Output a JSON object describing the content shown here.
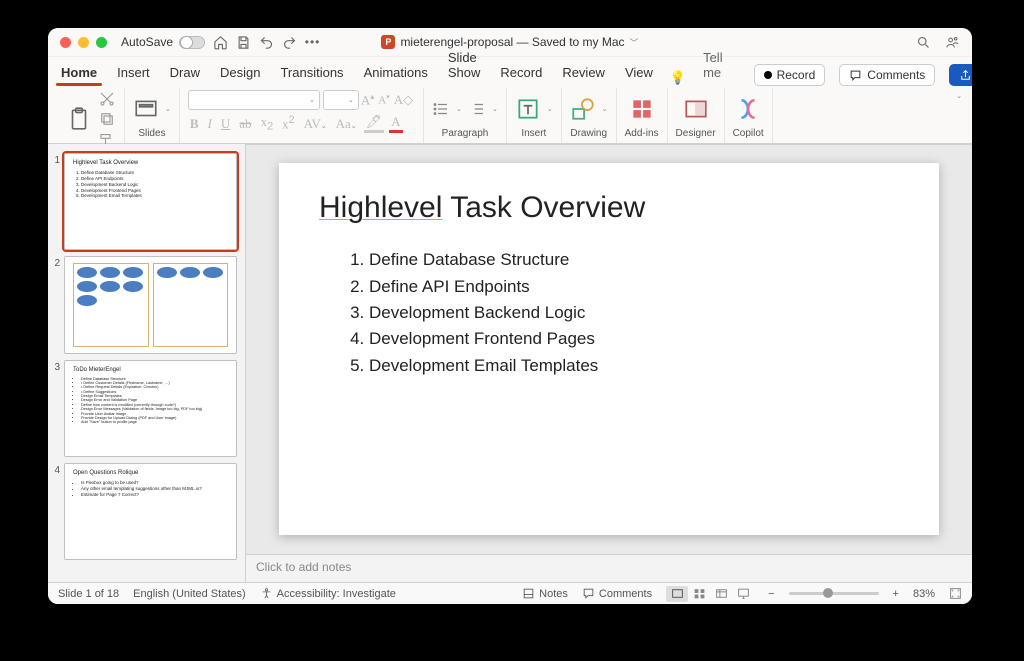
{
  "titlebar": {
    "autosave_label": "AutoSave",
    "doc_title": "mieterengel-proposal — Saved to my Mac"
  },
  "tabs": {
    "home": "Home",
    "insert": "Insert",
    "draw": "Draw",
    "design": "Design",
    "transitions": "Transitions",
    "animations": "Animations",
    "slideshow": "Slide Show",
    "record": "Record",
    "review": "Review",
    "view": "View",
    "tellme": "Tell me",
    "rec_btn": "Record",
    "comments_btn": "Comments",
    "share_btn": "Share"
  },
  "ribbon": {
    "paste": "Paste",
    "slides": "Slides",
    "paragraph": "Paragraph",
    "insert": "Insert",
    "drawing": "Drawing",
    "addins": "Add-ins",
    "designer": "Designer",
    "copilot": "Copilot"
  },
  "thumbs": {
    "1": {
      "title": "Highlevel Task Overview",
      "items": [
        "Define Database Structure",
        "Define API Endpoints",
        "Development Backend Logic",
        "Development Frontend Pages",
        "Development Email Templates"
      ]
    },
    "3": {
      "title": "ToDo MieterEngel",
      "items": [
        "Define Database Structure",
        "• Define Customer Details (Firstname, Lastname, …)",
        "• Define Request Details (Expiration, Checkin)",
        "• Define Suggestions",
        "Design Email Templates",
        "Design Error and Validation Page",
        "Define how content is modified (currently through code?)",
        "Design Error Messages (Validation of fields, Image too big, PDF too big)",
        "Provide User Avatar Image",
        "Provide Design for Upload Dialog (PDF and User Image)",
        "Add \"Save\" button to profile page"
      ]
    },
    "4": {
      "title": "Open Questions Rolique",
      "items": [
        "Is Flexbox going to be used?",
        "Any other email templating suggestions other than MJML.io?",
        "Estimate for Page 7 Correct?"
      ]
    }
  },
  "slide": {
    "title_underlined": "Highlevel",
    "title_rest": " Task Overview",
    "items": [
      "Define Database Structure",
      "Define API Endpoints",
      "Development Backend Logic",
      "Development Frontend Pages",
      "Development Email Templates"
    ]
  },
  "notes_placeholder": "Click to add notes",
  "status": {
    "slide_counter": "Slide 1 of 18",
    "language": "English (United States)",
    "accessibility": "Accessibility: Investigate",
    "notes": "Notes",
    "comments": "Comments",
    "zoom": "83%"
  }
}
